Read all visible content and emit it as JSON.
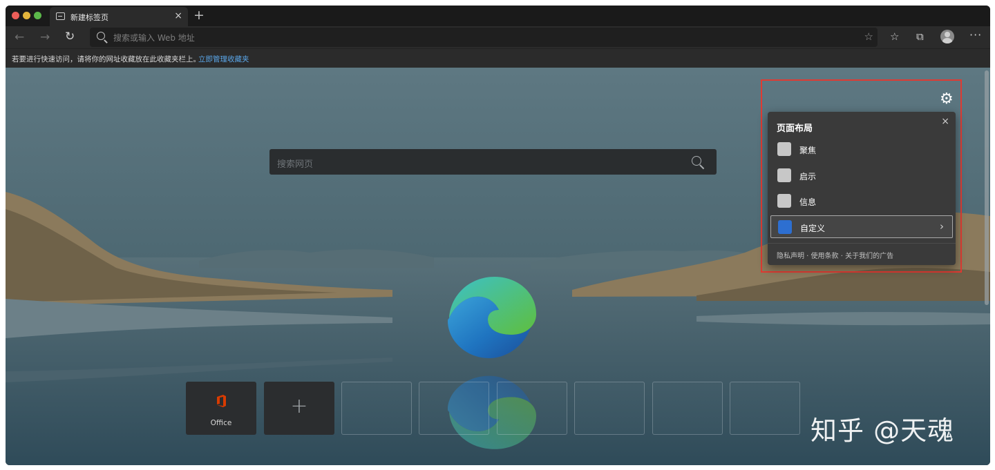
{
  "tab": {
    "title": "新建标签页",
    "close": "×",
    "new_tab": "+"
  },
  "toolbar": {
    "back": "←",
    "forward": "→",
    "reload": "↻",
    "address_placeholder": "搜索或输入 Web 地址",
    "star": "☆",
    "favorites": "☆",
    "collections": "⧉",
    "more": "···"
  },
  "favorites_bar": {
    "message": "若要进行快速访问，请将你的网址收藏放在此收藏夹栏上。",
    "link": "立即管理收藏夹"
  },
  "search": {
    "placeholder": "搜索网页"
  },
  "quick_links": [
    {
      "label": "Office"
    },
    {
      "label": "+"
    }
  ],
  "settings_panel": {
    "gear": "⚙",
    "title": "页面布局",
    "close": "×",
    "options": [
      {
        "label": "聚焦"
      },
      {
        "label": "启示"
      },
      {
        "label": "信息"
      },
      {
        "label": "自定义",
        "selected": true,
        "chevron": "›"
      }
    ],
    "footer": "隐私声明 · 使用条款 · 关于我们的广告"
  },
  "watermark": "知乎 @天魂",
  "colors": {
    "highlight": "#e03a32",
    "link": "#5aa6e8",
    "office_red": "#d83b01",
    "customize_blue": "#2d6fd1"
  }
}
